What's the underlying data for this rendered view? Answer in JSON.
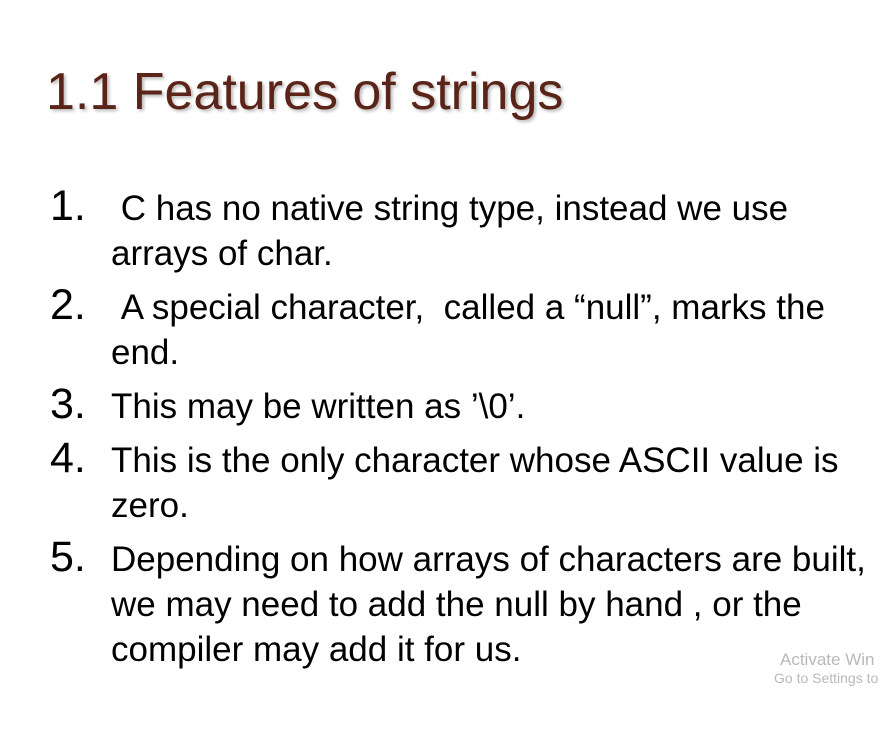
{
  "slide": {
    "title": "1.1 Features of strings",
    "items": [
      {
        "number": "1.",
        "text": " C has no native string type, instead we use arrays of char."
      },
      {
        "number": "2.",
        "text": " A special character,  called a “null”, marks the end."
      },
      {
        "number": "3.",
        "text": "This may be written as ’\\0’."
      },
      {
        "number": "4.",
        "text": "This is the only character whose ASCII value is zero."
      },
      {
        "number": "5.",
        "text": "Depending on how arrays of characters are built, we may need to add the null by hand , or the compiler may add it for us."
      }
    ]
  },
  "watermark": {
    "line1": "Activate Win",
    "line2": "Go to Settings to"
  },
  "colors": {
    "title": "#5a2418",
    "body_text": "#000000",
    "background": "#ffffff",
    "watermark": "#b9b9b9"
  }
}
